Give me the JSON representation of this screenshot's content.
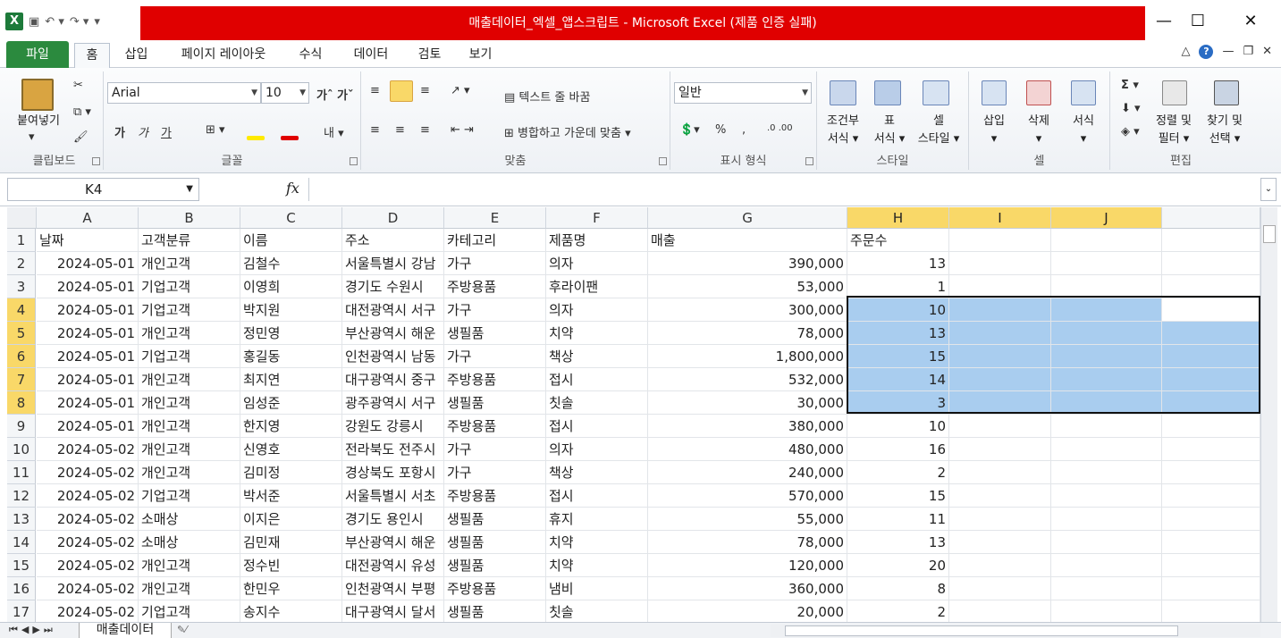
{
  "window": {
    "title": "매출데이터_엑셀_앱스크립트 - Microsoft Excel (제품 인증 실패)",
    "app_icon": "X"
  },
  "menu": {
    "file": "파일",
    "tabs": [
      "홈",
      "삽입",
      "페이지 레이아웃",
      "수식",
      "데이터",
      "검토",
      "보기"
    ]
  },
  "ribbon": {
    "clipboard": {
      "label": "클립보드",
      "paste": "붙여넣기"
    },
    "font": {
      "label": "글꼴",
      "name": "Arial",
      "size": "10",
      "bold": "가",
      "italic": "가",
      "underline": "가"
    },
    "align": {
      "label": "맞춤",
      "wrap": "텍스트 줄 바꿈",
      "merge": "병합하고 가운데 맞춤"
    },
    "number": {
      "label": "표시 형식",
      "format": "일반"
    },
    "styles": {
      "label": "스타일",
      "cond": [
        "조건부",
        "서식"
      ],
      "table": [
        "표",
        "서식"
      ],
      "cell": [
        "셀",
        "스타일"
      ]
    },
    "cells": {
      "label": "셀",
      "insert": "삽입",
      "delete": "삭제",
      "format": "서식"
    },
    "edit": {
      "label": "편집",
      "sort": [
        "정렬 및",
        "필터"
      ],
      "find": [
        "찾기 및",
        "선택"
      ]
    }
  },
  "formula_bar": {
    "name_box": "K4",
    "fx": "fx",
    "value": ""
  },
  "columns": [
    "A",
    "B",
    "C",
    "D",
    "E",
    "F",
    "G",
    "H",
    "I",
    "J"
  ],
  "header_row": [
    "날짜",
    "고객분류",
    "이름",
    "주소",
    "카테고리",
    "제품명",
    "매출",
    "주문수"
  ],
  "rows": [
    [
      "2024-05-01",
      "개인고객",
      "김철수",
      "서울특별시 강남",
      "가구",
      "의자",
      "390,000",
      "13"
    ],
    [
      "2024-05-01",
      "기업고객",
      "이영희",
      "경기도 수원시",
      "주방용품",
      "후라이팬",
      "53,000",
      "1"
    ],
    [
      "2024-05-01",
      "기업고객",
      "박지원",
      "대전광역시 서구",
      "가구",
      "의자",
      "300,000",
      "10"
    ],
    [
      "2024-05-01",
      "개인고객",
      "정민영",
      "부산광역시 해운",
      "생필품",
      "치약",
      "78,000",
      "13"
    ],
    [
      "2024-05-01",
      "기업고객",
      "홍길동",
      "인천광역시 남동",
      "가구",
      "책상",
      "1,800,000",
      "15"
    ],
    [
      "2024-05-01",
      "개인고객",
      "최지연",
      "대구광역시 중구",
      "주방용품",
      "접시",
      "532,000",
      "14"
    ],
    [
      "2024-05-01",
      "개인고객",
      "임성준",
      "광주광역시 서구",
      "생필품",
      "칫솔",
      "30,000",
      "3"
    ],
    [
      "2024-05-01",
      "개인고객",
      "한지영",
      "강원도 강릉시",
      "주방용품",
      "접시",
      "380,000",
      "10"
    ],
    [
      "2024-05-02",
      "개인고객",
      "신영호",
      "전라북도 전주시",
      "가구",
      "의자",
      "480,000",
      "16"
    ],
    [
      "2024-05-02",
      "개인고객",
      "김미정",
      "경상북도 포항시",
      "가구",
      "책상",
      "240,000",
      "2"
    ],
    [
      "2024-05-02",
      "기업고객",
      "박서준",
      "서울특별시 서초",
      "주방용품",
      "접시",
      "570,000",
      "15"
    ],
    [
      "2024-05-02",
      "소매상",
      "이지은",
      "경기도 용인시",
      "생필품",
      "휴지",
      "55,000",
      "11"
    ],
    [
      "2024-05-02",
      "소매상",
      "김민재",
      "부산광역시 해운",
      "생필품",
      "치약",
      "78,000",
      "13"
    ],
    [
      "2024-05-02",
      "개인고객",
      "정수빈",
      "대전광역시 유성",
      "생필품",
      "치약",
      "120,000",
      "20"
    ],
    [
      "2024-05-02",
      "개인고객",
      "한민우",
      "인천광역시 부평",
      "주방용품",
      "냄비",
      "360,000",
      "8"
    ],
    [
      "2024-05-02",
      "기업고객",
      "송지수",
      "대구광역시 달서",
      "생필품",
      "칫솔",
      "20,000",
      "2"
    ]
  ],
  "sheet_tab": "매출데이터",
  "accent": {
    "selection": "#a9cdef",
    "header_sel": "#f9d868",
    "title_bg": "#e00000",
    "file_tab": "#2b8a3e"
  }
}
